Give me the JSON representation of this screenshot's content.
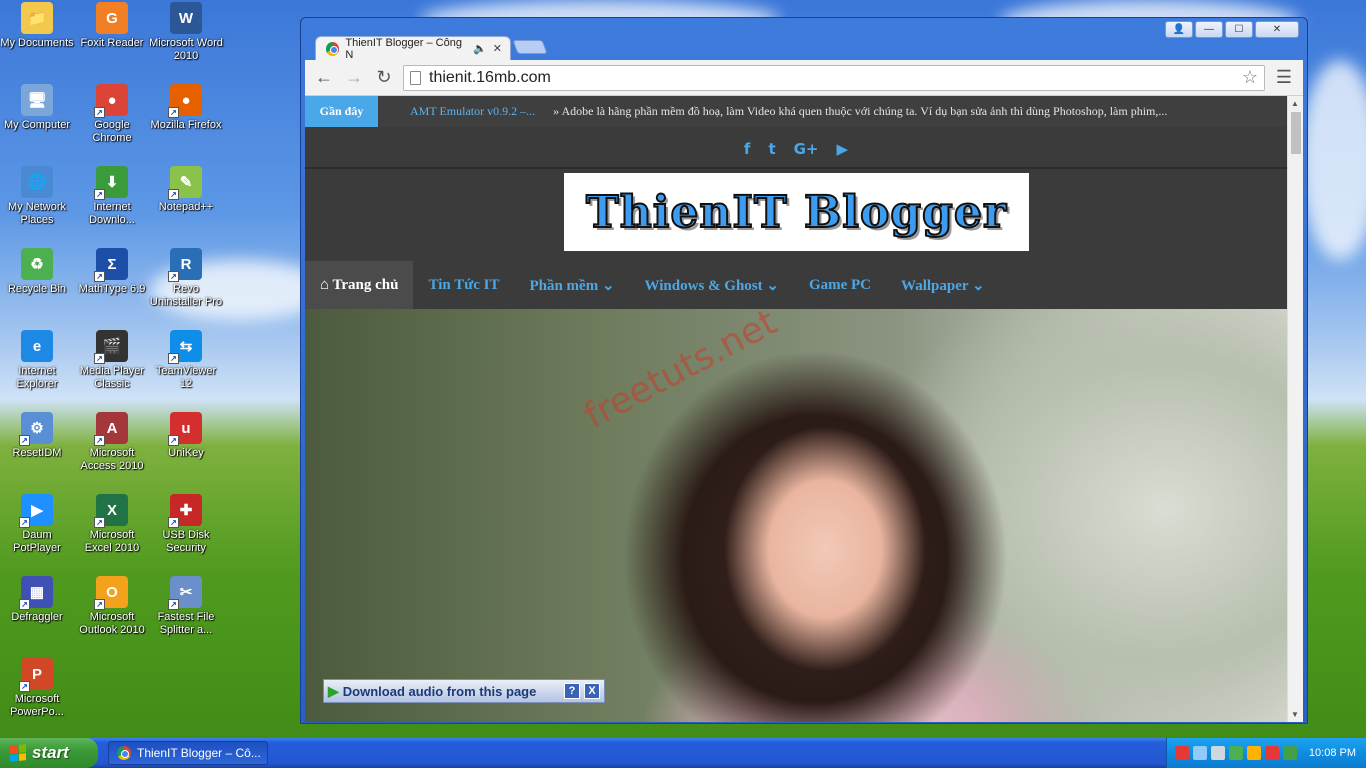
{
  "desktop": {
    "icons": [
      {
        "label": "My Documents",
        "icon": "folder-documents-icon",
        "color": "#f2c94c",
        "glyph": "📁"
      },
      {
        "label": "Foxit Reader",
        "icon": "foxit-reader-icon",
        "color": "#f07f26",
        "glyph": "G"
      },
      {
        "label": "Microsoft Word 2010",
        "icon": "word-icon",
        "color": "#2b5797",
        "glyph": "W"
      },
      {
        "label": "My Computer",
        "icon": "computer-icon",
        "color": "#7aa6d9",
        "glyph": "🖥"
      },
      {
        "label": "Google Chrome",
        "icon": "chrome-icon",
        "color": "#db4437",
        "glyph": "●"
      },
      {
        "label": "Mozilla Firefox",
        "icon": "firefox-icon",
        "color": "#e66000",
        "glyph": "●"
      },
      {
        "label": "My Network Places",
        "icon": "network-places-icon",
        "color": "#4a8ad4",
        "glyph": "🌐"
      },
      {
        "label": "Internet Downlo...",
        "icon": "idm-icon",
        "color": "#3a9b3a",
        "glyph": "⬇"
      },
      {
        "label": "Notepad++",
        "icon": "notepadpp-icon",
        "color": "#8bc34a",
        "glyph": "✎"
      },
      {
        "label": "Recycle Bin",
        "icon": "recycle-bin-icon",
        "color": "#4caf50",
        "glyph": "♻"
      },
      {
        "label": "MathType 6.9",
        "icon": "mathtype-icon",
        "color": "#1d4fa8",
        "glyph": "Σ"
      },
      {
        "label": "Revo Uninstaller Pro",
        "icon": "revo-uninstaller-icon",
        "color": "#2a6fb5",
        "glyph": "R"
      },
      {
        "label": "Internet Explorer",
        "icon": "internet-explorer-icon",
        "color": "#1e88e5",
        "glyph": "e"
      },
      {
        "label": "Media Player Classic",
        "icon": "media-player-classic-icon",
        "color": "#333333",
        "glyph": "🎬"
      },
      {
        "label": "TeamViewer 12",
        "icon": "teamviewer-icon",
        "color": "#0e8ee9",
        "glyph": "⇆"
      },
      {
        "label": "ResetIDM",
        "icon": "resetidm-icon",
        "color": "#5a8fd6",
        "glyph": "⚙"
      },
      {
        "label": "Microsoft Access 2010",
        "icon": "access-icon",
        "color": "#a4373a",
        "glyph": "A"
      },
      {
        "label": "UniKey",
        "icon": "unikey-icon",
        "color": "#d32f2f",
        "glyph": "u"
      },
      {
        "label": "Daum PotPlayer",
        "icon": "potplayer-icon",
        "color": "#1e90ff",
        "glyph": "▶"
      },
      {
        "label": "Microsoft Excel 2010",
        "icon": "excel-icon",
        "color": "#217346",
        "glyph": "X"
      },
      {
        "label": "USB Disk Security",
        "icon": "usb-disk-security-icon",
        "color": "#c62828",
        "glyph": "✚"
      },
      {
        "label": "Defraggler",
        "icon": "defraggler-icon",
        "color": "#3f51b5",
        "glyph": "▦"
      },
      {
        "label": "Microsoft Outlook 2010",
        "icon": "outlook-icon",
        "color": "#f4a21c",
        "glyph": "O"
      },
      {
        "label": "Fastest File Splitter a...",
        "icon": "file-splitter-icon",
        "color": "#6a8fc9",
        "glyph": "✂"
      },
      {
        "label": "Microsoft PowerPo...",
        "icon": "powerpoint-icon",
        "color": "#d24726",
        "glyph": "P"
      }
    ]
  },
  "window": {
    "tab_title": "ThienIT Blogger – Công N",
    "url": "thienit.16mb.com",
    "controls": {
      "user": "👤",
      "minimize": "—",
      "maximize": "☐",
      "close": "✕"
    }
  },
  "page": {
    "recent_label": "Gần đây",
    "recent_item": "AMT Emulator v0.9.2 –...",
    "recent_desc": "» Adobe là hãng phần mềm đồ hoạ, làm Video khá quen thuộc với chúng ta. Ví dụ bạn sửa ảnh thì dùng Photoshop, làm phim,...",
    "social": [
      "f",
      "t",
      "G+",
      "▶"
    ],
    "logo_text": "ThienIT Blogger",
    "menu": [
      {
        "label": "⌂ Trang chủ",
        "active": true
      },
      {
        "label": "Tin Tức IT",
        "active": false
      },
      {
        "label": "Phần mềm ⌄",
        "active": false
      },
      {
        "label": "Windows & Ghost ⌄",
        "active": false
      },
      {
        "label": "Game PC",
        "active": false
      },
      {
        "label": "Wallpaper ⌄",
        "active": false
      }
    ],
    "watermark": "freetuts.net",
    "download_bar": {
      "label": "Download audio from this page",
      "help": "?",
      "close": "X"
    }
  },
  "taskbar": {
    "start_label": "start",
    "task_label": "ThienIT Blogger – Cô...",
    "clock": "10:08 PM",
    "tray_colors": [
      "#e53935",
      "#90caf9",
      "#cfd8dc",
      "#4caf50",
      "#ffb300",
      "#e53935",
      "#43a047"
    ]
  },
  "colors": {
    "accent": "#4aa7e8",
    "page_bg": "#3b3b3b"
  }
}
